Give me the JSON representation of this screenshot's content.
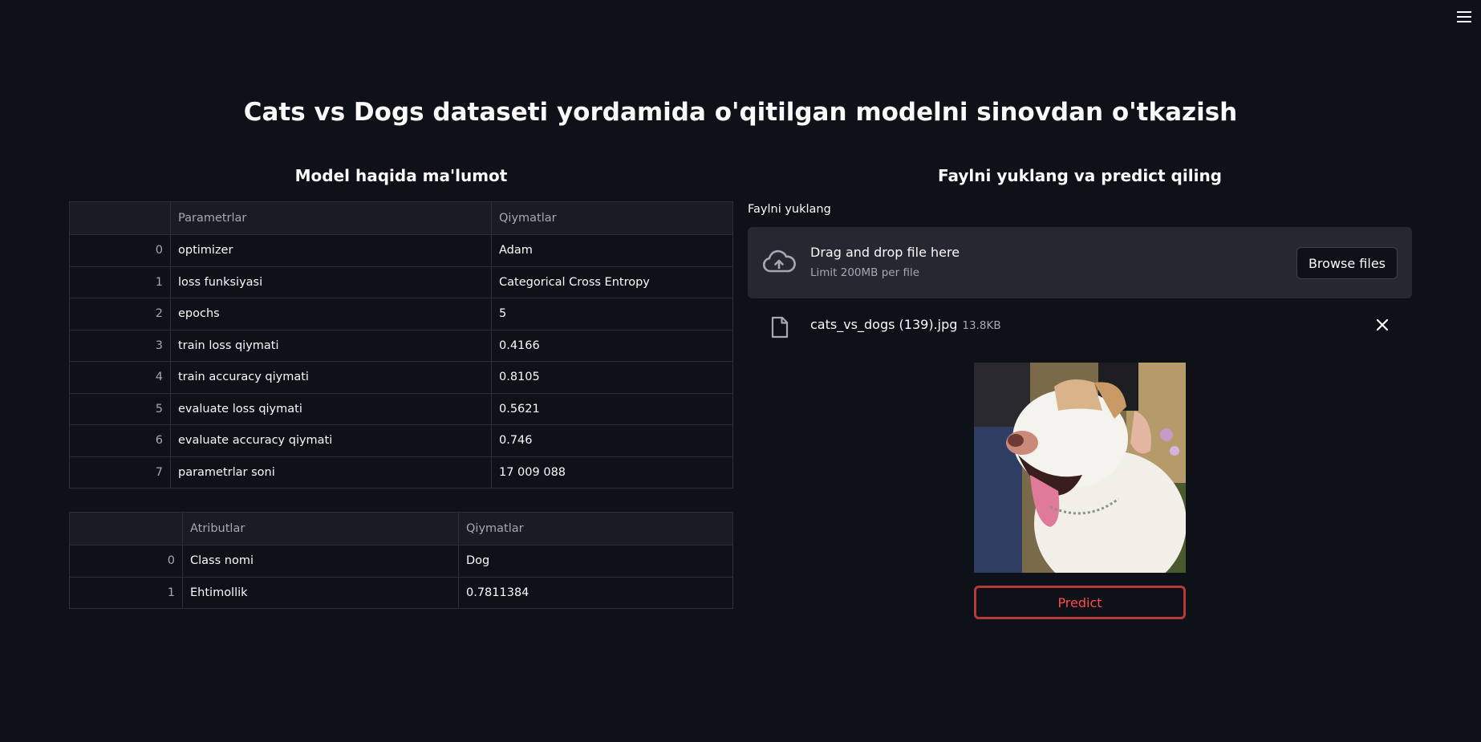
{
  "title": "Cats vs Dogs dataseti yordamida o'qitilgan modelni sinovdan o'tkazish",
  "left": {
    "heading": "Model haqida ma'lumot",
    "table1": {
      "columns": [
        "",
        "Parametrlar",
        "Qiymatlar"
      ],
      "rows": [
        [
          "0",
          "optimizer",
          "Adam"
        ],
        [
          "1",
          "loss funksiyasi",
          "Categorical Cross Entropy"
        ],
        [
          "2",
          "epochs",
          "5"
        ],
        [
          "3",
          "train loss qiymati",
          "0.4166"
        ],
        [
          "4",
          "train accuracy qiymati",
          "0.8105"
        ],
        [
          "5",
          "evaluate loss qiymati",
          "0.5621"
        ],
        [
          "6",
          "evaluate accuracy qiymati",
          "0.746"
        ],
        [
          "7",
          "parametrlar soni",
          "17 009 088"
        ]
      ]
    },
    "table2": {
      "columns": [
        "",
        "Atributlar",
        "Qiymatlar"
      ],
      "rows": [
        [
          "0",
          "Class nomi",
          "Dog"
        ],
        [
          "1",
          "Ehtimollik",
          "0.7811384"
        ]
      ]
    }
  },
  "right": {
    "heading": "Faylni yuklang va predict qiling",
    "upload_label": "Faylni yuklang",
    "dropzone_text": "Drag and drop file here",
    "dropzone_limit": "Limit 200MB per file",
    "browse_label": "Browse files",
    "file_name": "cats_vs_dogs (139).jpg",
    "file_size": "13.8KB",
    "predict_label": "Predict"
  },
  "colors": {
    "background": "#0e1117",
    "panel": "#262730",
    "accent": "#ff4b4b"
  }
}
